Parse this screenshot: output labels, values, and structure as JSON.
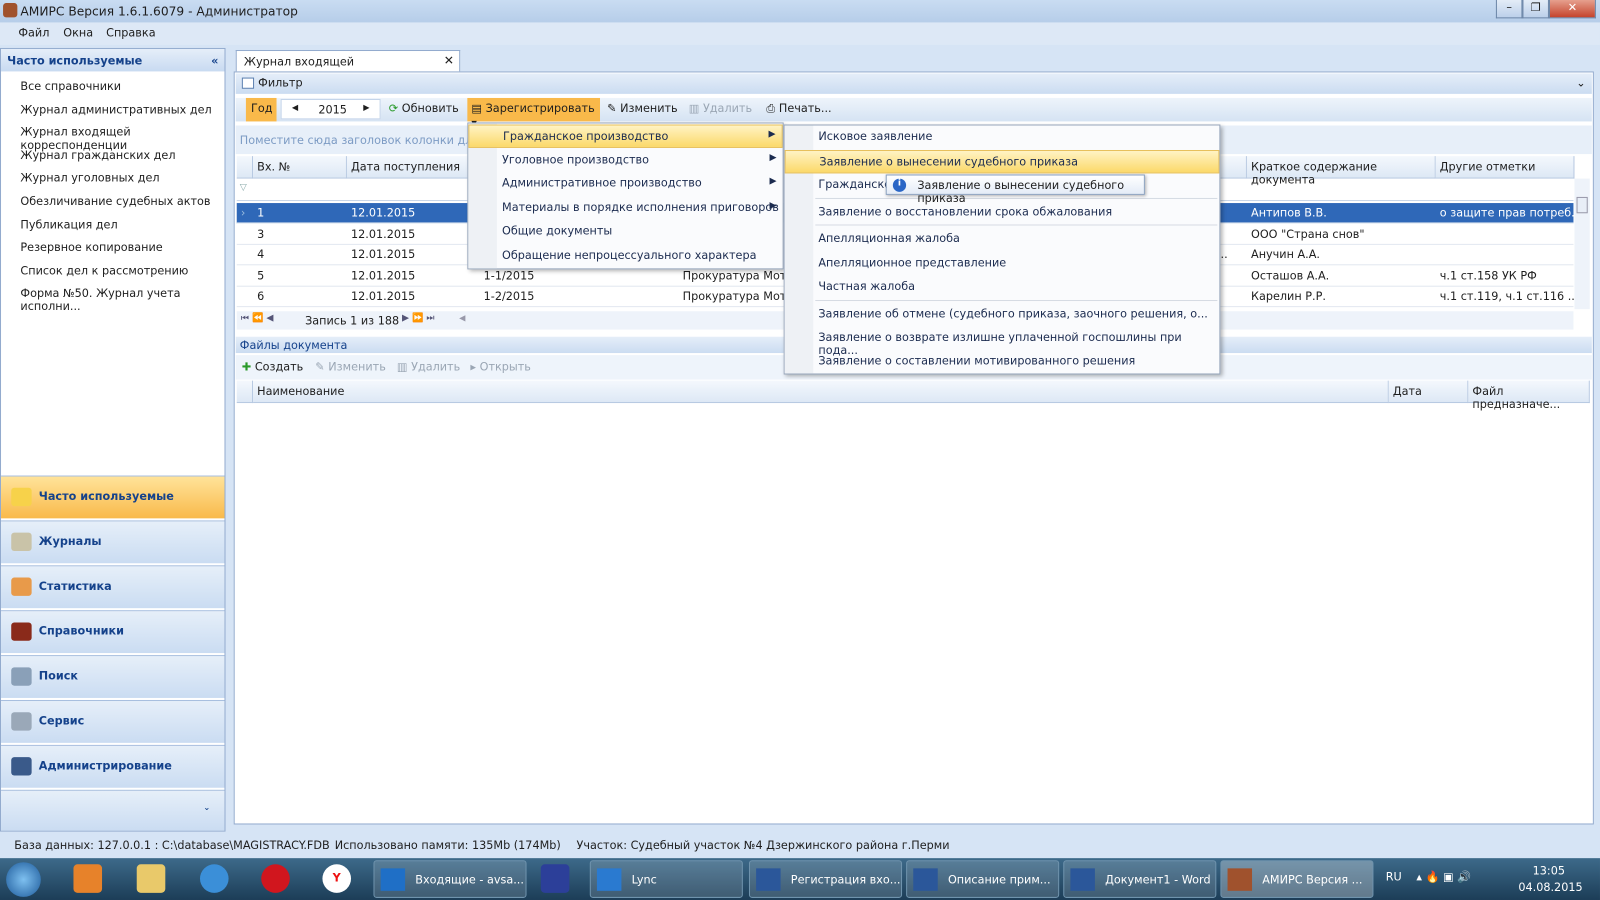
{
  "window": {
    "title": "АМИРС Версия 1.6.1.6079 - Администратор"
  },
  "menubar": [
    "Файл",
    "Окна",
    "Справка"
  ],
  "left_panel": {
    "title": "Часто используемые",
    "items": [
      "Все справочники",
      "Журнал административных дел",
      "Журнал входящей корреспонденции",
      "Журнал гражданских дел",
      "Журнал уголовных дел",
      "Обезличивание судебных актов",
      "Публикация дел",
      "Резервное копирование",
      "Список дел к рассмотрению",
      "Форма №50. Журнал учета исполни..."
    ],
    "nav": [
      {
        "label": "Часто используемые",
        "icon": "star-folder-icon",
        "active": true
      },
      {
        "label": "Журналы",
        "icon": "book-icon"
      },
      {
        "label": "Статистика",
        "icon": "chart-icon"
      },
      {
        "label": "Справочники",
        "icon": "books-icon"
      },
      {
        "label": "Поиск",
        "icon": "search-icon"
      },
      {
        "label": "Сервис",
        "icon": "gears-icon"
      },
      {
        "label": "Администрирование",
        "icon": "user-icon"
      }
    ]
  },
  "tab": {
    "label": "Журнал входящей корреспонденции"
  },
  "filter": {
    "label": "Фильтр"
  },
  "toolbar": {
    "year_label": "Год",
    "year": "2015",
    "refresh": "Обновить",
    "register": "Зарегистрировать",
    "edit": "Изменить",
    "delete": "Удалить",
    "print": "Печать..."
  },
  "grid": {
    "group_hint": "Поместите сюда заголовок колонки для гру",
    "columns": [
      "Вх. №",
      "Дата поступления",
      "Краткое содержание документа",
      "Другие отметки"
    ],
    "rows": [
      [
        "1",
        "12.01.2015",
        "",
        "",
        "",
        "Антипов В.В.",
        "о защите прав потреб..."
      ],
      [
        "3",
        "12.01.2015",
        "",
        "",
        "",
        "ООО \"Страна снов\"",
        ""
      ],
      [
        "4",
        "12.01.2015",
        "",
        "",
        "и ...",
        "Анучин А.А.",
        ""
      ],
      [
        "5",
        "12.01.2015",
        "1-1/2015",
        "Прокуратура Мотов",
        "",
        "Осташов А.А.",
        "ч.1 ст.158 УК РФ"
      ],
      [
        "6",
        "12.01.2015",
        "1-2/2015",
        "Прокуратура Мотов",
        "",
        "Карелин Р.Р.",
        "ч.1 ст.119, ч.1 ст.116 ..."
      ]
    ],
    "pager": "Запись 1 из 188"
  },
  "files": {
    "title": "Файлы документа",
    "create": "Создать",
    "edit": "Изменить",
    "delete": "Удалить",
    "open": "Открыть",
    "columns": [
      "Наименование",
      "Дата",
      "Файл предназначе..."
    ]
  },
  "register_menu": [
    {
      "label": "Гражданское производство",
      "sub": true,
      "highlighted": true
    },
    {
      "label": "Уголовное производство",
      "sub": true
    },
    {
      "label": "Административное производство",
      "sub": true
    },
    {
      "label": "Материалы в порядке исполнения приговоров",
      "sub": true
    },
    {
      "label": "Общие документы"
    },
    {
      "label": "Обращение непроцессуального характера"
    }
  ],
  "civil_submenu": [
    "Исковое заявление",
    "Заявление о вынесении судебного приказа",
    "Гражданско",
    "Заявление о восстановлении срока обжалования",
    "Апелляционная жалоба",
    "Апелляционное представление",
    "Частная жалоба",
    "Заявление об отмене (судебного приказа, заочного решения, о...",
    "Заявление о возврате излишне уплаченной госпошлины при пода...",
    "Заявление о составлении мотивированного решения"
  ],
  "tooltip": "Заявление о вынесении судебного приказа",
  "status": {
    "db": "База данных: 127.0.0.1 : C:\\database\\MAGISTRACY.FDB",
    "memory": "Использовано памяти: 135Mb (174Mb)",
    "site": "Участок: Судебный участок №4 Дзержинского района г.Перми"
  },
  "taskbar": {
    "tasks": [
      "Входящие - avsa...",
      "Lync",
      "Регистрация вхо...",
      "Описание прим...",
      "Документ1 - Word",
      "АМИРС Версия ..."
    ],
    "lang": "RU",
    "time": "13:05",
    "date": "04.08.2015"
  },
  "colors": {
    "accent": "#f9b94a",
    "selection": "#2f68b8",
    "header": "#15428b"
  }
}
